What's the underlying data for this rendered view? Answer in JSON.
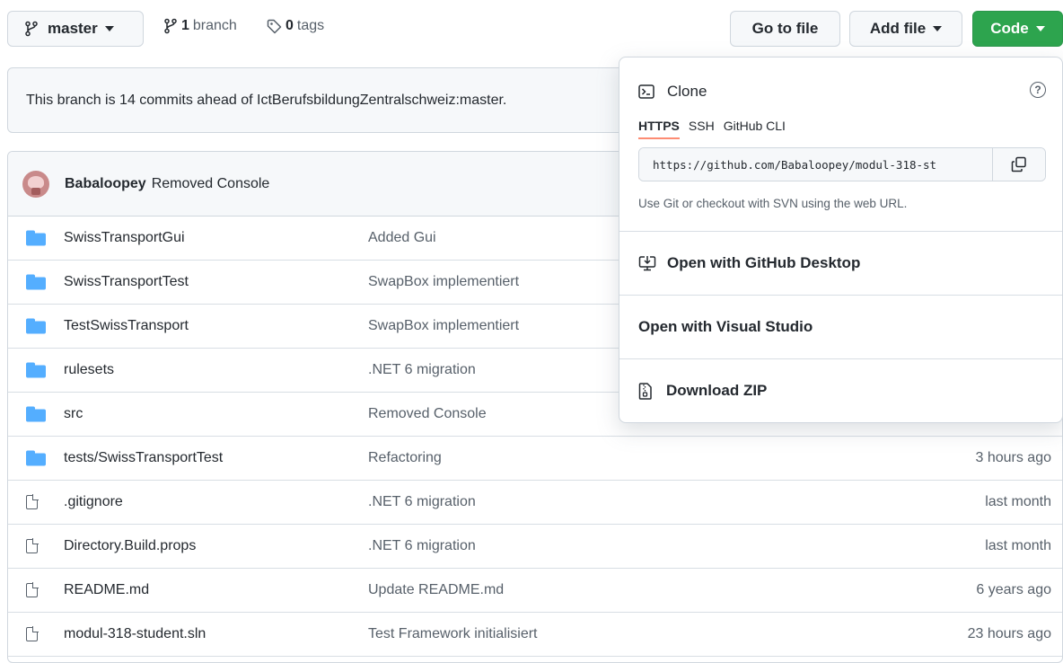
{
  "toolbar": {
    "branch_label": "master",
    "branch_count": "1",
    "branch_word": "branch",
    "tag_count": "0",
    "tag_word": "tags",
    "go_to_file": "Go to file",
    "add_file": "Add file",
    "code": "Code",
    "code_color": "#2da44e"
  },
  "ahead_notice": "This branch is 14 commits ahead of IctBerufsbildungZentralschweiz:master.",
  "latest_commit": {
    "author": "Babaloopey",
    "message": "Removed Console"
  },
  "files": [
    {
      "type": "folder",
      "name": "SwissTransportGui",
      "message": "Added Gui",
      "age": ""
    },
    {
      "type": "folder",
      "name": "SwissTransportTest",
      "message": "SwapBox implementiert",
      "age": ""
    },
    {
      "type": "folder",
      "name": "TestSwissTransport",
      "message": "SwapBox implementiert",
      "age": ""
    },
    {
      "type": "folder",
      "name": "rulesets",
      "message": ".NET 6 migration",
      "age": ""
    },
    {
      "type": "folder",
      "name": "src",
      "message": "Removed Console",
      "age": ""
    },
    {
      "type": "folder",
      "name": "tests/SwissTransportTest",
      "message": "Refactoring",
      "age": "3 hours ago"
    },
    {
      "type": "file",
      "name": ".gitignore",
      "message": ".NET 6 migration",
      "age": "last month"
    },
    {
      "type": "file",
      "name": "Directory.Build.props",
      "message": ".NET 6 migration",
      "age": "last month"
    },
    {
      "type": "file",
      "name": "README.md",
      "message": "Update README.md",
      "age": "6 years ago"
    },
    {
      "type": "file",
      "name": "modul-318-student.sln",
      "message": "Test Framework initialisiert",
      "age": "23 hours ago"
    }
  ],
  "clone_popup": {
    "title": "Clone",
    "help": "?",
    "tabs": [
      "HTTPS",
      "SSH",
      "GitHub CLI"
    ],
    "active_tab": "HTTPS",
    "url": "https://github.com/Babaloopey/modul-318-st",
    "hint": "Use Git or checkout with SVN using the web URL.",
    "open_desktop": "Open with GitHub Desktop",
    "open_vs": "Open with Visual Studio",
    "download_zip": "Download ZIP",
    "tab_underline_color": "#fd8c73"
  }
}
